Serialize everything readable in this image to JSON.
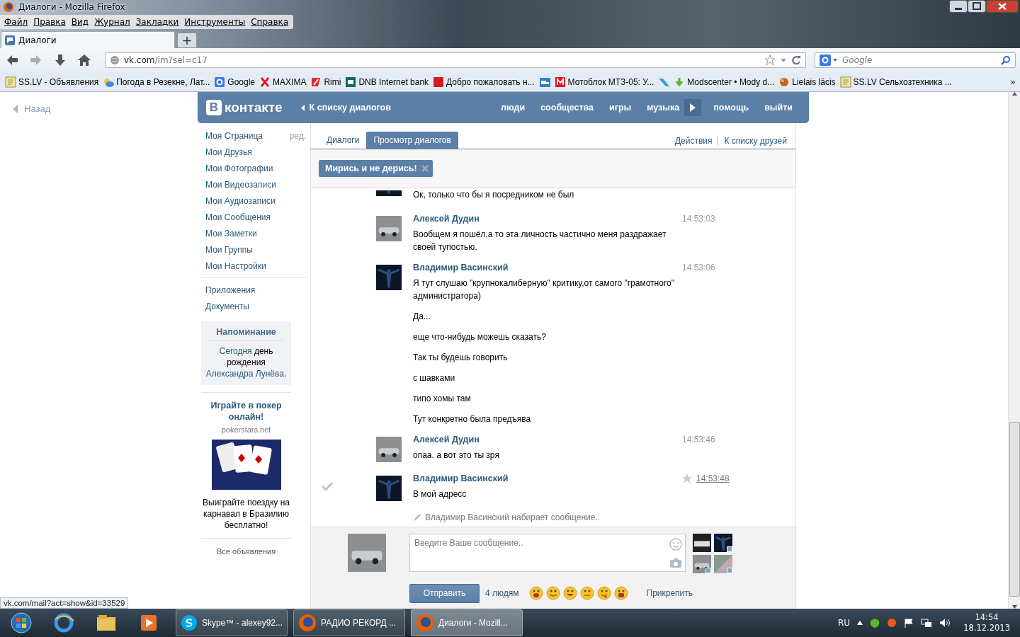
{
  "window": {
    "title": "Диалоги - Mozilla Firefox"
  },
  "menu": [
    "Файл",
    "Правка",
    "Вид",
    "Журнал",
    "Закладки",
    "Инструменты",
    "Справка"
  ],
  "tabs": [
    {
      "label": "Диалоги",
      "selected": true
    }
  ],
  "new_tab": "+",
  "address": {
    "host": "vk.com",
    "path": "/im?sel=c17"
  },
  "search": {
    "placeholder": "Google"
  },
  "bookmarks": [
    {
      "kind": "note",
      "label": "SS.LV - Объявления"
    },
    {
      "kind": "weather",
      "label": "Погода в Резекне, Лат..."
    },
    {
      "kind": "google",
      "label": "Google"
    },
    {
      "kind": "maxima",
      "label": "MAXIMA"
    },
    {
      "kind": "rimi",
      "label": "Rimi"
    },
    {
      "kind": "dnb",
      "label": "DNB Internet bank"
    },
    {
      "kind": "rt",
      "label": "Добро пожаловать н..."
    },
    {
      "kind": "truck"
    },
    {
      "kind": "m",
      "label": "Мотоблок МТЗ-05: У..."
    },
    {
      "kind": "ribbon"
    },
    {
      "kind": "download",
      "label": "Modscenter • Mody d..."
    },
    {
      "kind": "ball",
      "label": "Lielais lācis"
    },
    {
      "kind": "note",
      "label": "SS.LV Сельхозтехника ..."
    }
  ],
  "bookmarks_more": "»",
  "vk": {
    "back": "Назад",
    "logo": {
      "letter": "В",
      "word": "контакте"
    },
    "header_back": "К списку диалогов",
    "nav": [
      {
        "kind": "link",
        "label": "люди"
      },
      {
        "kind": "link",
        "label": "сообщества"
      },
      {
        "kind": "link",
        "label": "игры"
      },
      {
        "kind": "link",
        "label": "музыка"
      },
      {
        "kind": "player"
      },
      {
        "kind": "link",
        "label": "помощь"
      },
      {
        "kind": "link",
        "label": "выйти"
      }
    ],
    "sidebar": {
      "edit": "ред.",
      "groups": [
        [
          "Моя Страница",
          "Мои Друзья",
          "Мои Фотографии",
          "Мои Видеозаписи",
          "Мои Аудиозаписи",
          "Мои Сообщения",
          "Мои Заметки",
          "Мои Группы",
          "Мои Настройки"
        ],
        [
          "Приложения",
          "Документы"
        ]
      ]
    },
    "reminder": {
      "title": "Напоминание",
      "parts": [
        {
          "text": "Сегодня",
          "kind": "link"
        },
        {
          "text": " день рождения ",
          "kind": "plain"
        },
        {
          "text": "Александра Лунёва",
          "kind": "link"
        },
        {
          "text": ".",
          "kind": "plain"
        }
      ]
    },
    "ad": {
      "title": "Играйте в покер онлайн!",
      "domain": "pokerstars.net",
      "caption": "Выиграйте поездку на карнавал в Бразилию бесплатно!",
      "all": "Все объявления"
    },
    "tabs": [
      {
        "label": "Диалоги",
        "selected": false
      },
      {
        "label": "Просмотр диалогов",
        "selected": true
      }
    ],
    "actions": [
      "Действия",
      "К списку друзей"
    ],
    "chat_title": "Мирись и не дерись!",
    "messages": [
      {
        "kind": "continued",
        "avatar": {
          "kind": "figure"
        },
        "texts": [
          "Ок, только что бы я посредником не был"
        ],
        "highlighted": false
      },
      {
        "kind": "group",
        "author": "Алексей Дудин",
        "avatar": {
          "kind": "car"
        },
        "time": "14:53:03",
        "texts": [
          "Вообщем я пошёл,а то эта личность частично меня раздражает своей тупостью."
        ],
        "highlighted": false
      },
      {
        "kind": "group",
        "author": "Владимир Васинский",
        "avatar": {
          "kind": "figure"
        },
        "time": "14:53:06",
        "texts": [
          "Я тут слушаю \"крупнокалиберную\" критику,от самого \"грамотного\" администратора)",
          "Да...",
          "еще что-нибудь можешь сказать?",
          "Так ты будешь говорить",
          "с шавками",
          "типо хомы там",
          "Тут конкретно была предъява"
        ],
        "highlighted": false
      },
      {
        "kind": "group",
        "author": "Алексей Дудин",
        "avatar": {
          "kind": "car"
        },
        "time": "14:53:46",
        "texts": [
          "опаа. а вот это ты зря"
        ],
        "highlighted": false
      },
      {
        "kind": "group",
        "author": "Владимир Васинский",
        "avatar": {
          "kind": "figure"
        },
        "time": "14:53:48",
        "texts": [
          "В мой адресс"
        ],
        "highlighted": true
      }
    ],
    "typing": "Владимир Васинский набирает сообщение..",
    "composer": {
      "placeholder": "Введите Ваше сообщение..",
      "send": "Отправить",
      "recipients": "4 людям",
      "attach": "Прикрепить",
      "participants": [
        {
          "kind": "dark",
          "online": false
        },
        {
          "kind": "figure",
          "online": true
        },
        {
          "kind": "car",
          "online": true
        },
        {
          "kind": "photo",
          "online": true
        }
      ]
    }
  },
  "status_url": "vk.com/mail?act=show&id=33529",
  "taskbar": {
    "items": [
      {
        "kind": "skype",
        "label": "Skype™ - alexey92...",
        "selected": false
      },
      {
        "kind": "firefox",
        "label": "РАДИО РЕКОРД ...",
        "selected": false
      },
      {
        "kind": "firefox",
        "label": "Диалоги - Mozill...",
        "selected": true
      }
    ],
    "lang": "RU",
    "time": "14:54",
    "date": "18.12.2013"
  }
}
